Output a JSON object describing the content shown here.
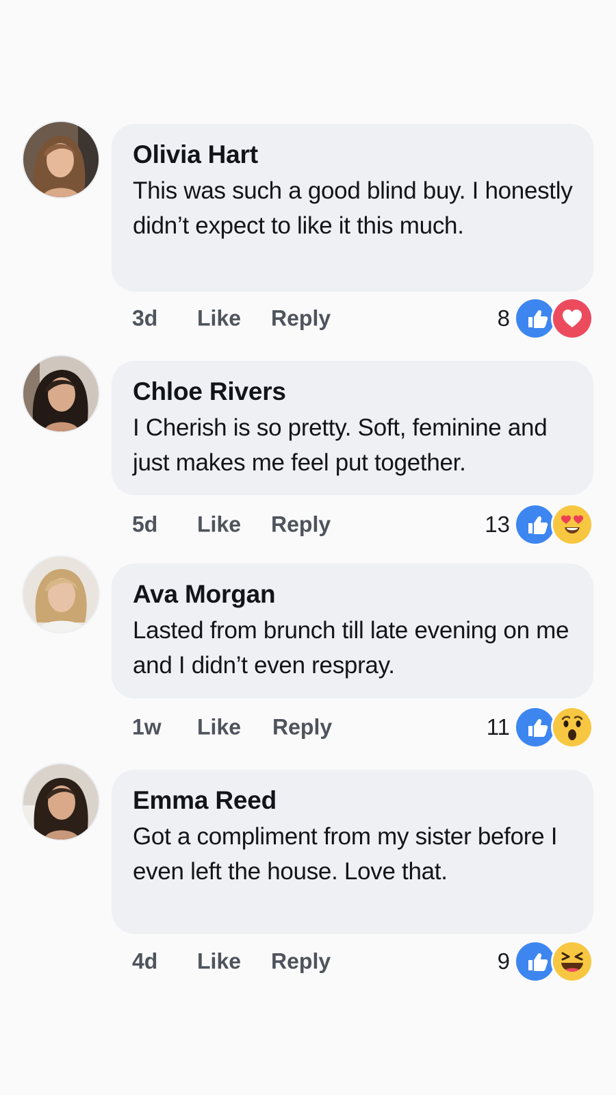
{
  "colors": {
    "bubble": "#eef0f4",
    "like_blue": "#3d86f0",
    "love_red": "#ec4b5e",
    "emoji_yellow": "#f8c741"
  },
  "comments": [
    {
      "name": "Olivia Hart",
      "text": "This was such a good blind buy. I honestly didn’t expect to like it this much.",
      "age": "3d",
      "like_label": "Like",
      "reply_label": "Reply",
      "reaction_count": "8",
      "reactions": [
        "like-icon",
        "love-icon"
      ]
    },
    {
      "name": "Chloe Rivers",
      "text": "I Cherish is so pretty. Soft, feminine and just makes me feel put together.",
      "age": "5d",
      "like_label": "Like",
      "reply_label": "Reply",
      "reaction_count": "13",
      "reactions": [
        "like-icon",
        "heart-eyes-icon"
      ]
    },
    {
      "name": "Ava Morgan",
      "text": "Lasted from brunch till late evening on me and I didn’t even respray.",
      "age": "1w",
      "like_label": "Like",
      "reply_label": "Reply",
      "reaction_count": "11",
      "reactions": [
        "like-icon",
        "wow-icon"
      ]
    },
    {
      "name": "Emma Reed",
      "text": "Got a compliment from my sister before I even left the house. Love that.",
      "age": "4d",
      "like_label": "Like",
      "reply_label": "Reply",
      "reaction_count": "9",
      "reactions": [
        "like-icon",
        "haha-icon"
      ]
    }
  ]
}
